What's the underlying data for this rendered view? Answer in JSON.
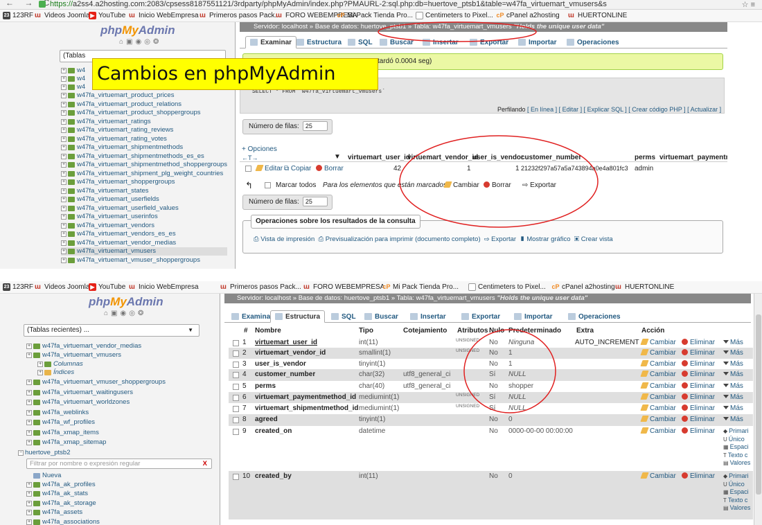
{
  "browser": {
    "url_prefix": "https://",
    "url": "a2ss4.a2hosting.com:2083/cpsess8187551121/3rdparty/phpMyAdmin/index.php?PMAURL-2:sql.php:db=huertove_ptsb1&table=w47fa_virtuemart_vmusers&s"
  },
  "bookmarks": [
    {
      "icon": "123rf-icon",
      "label": "123RF"
    },
    {
      "icon": "joomla-icon",
      "label": "Videos Joomla"
    },
    {
      "icon": "youtube-icon",
      "label": "YouTube"
    },
    {
      "icon": "joomla-icon",
      "label": "Inicio WebEmpresa"
    },
    {
      "icon": "joomla-icon",
      "label": "Primeros pasos Pack..."
    },
    {
      "icon": "joomla-icon",
      "label": "FORO WEBEMPRESA"
    },
    {
      "icon": "cpanel-icon",
      "label": "Mi Pack Tienda Pro..."
    },
    {
      "icon": "page-icon",
      "label": "Centimeters to Pixel..."
    },
    {
      "icon": "cpanel-icon",
      "label": "cPanel a2hosting"
    },
    {
      "icon": "joomla-icon",
      "label": "HUERTONLINE"
    }
  ],
  "logo": {
    "php": "php",
    "my": "My",
    "admin": "Admin"
  },
  "overlay_banner": "Cambios en phpMyAdmin",
  "top": {
    "recent_tables": "(Tablas",
    "tree": [
      "w47fa_virtuemart_product_prices",
      "w47fa_virtuemart_product_relations",
      "w47fa_virtuemart_product_shoppergroups",
      "w47fa_virtuemart_ratings",
      "w47fa_virtuemart_rating_reviews",
      "w47fa_virtuemart_rating_votes",
      "w47fa_virtuemart_shipmentmethods",
      "w47fa_virtuemart_shipmentmethods_es_es",
      "w47fa_virtuemart_shipmentmethod_shoppergroups",
      "w47fa_virtuemart_shipment_plg_weight_countries",
      "w47fa_virtuemart_shoppergroups",
      "w47fa_virtuemart_states",
      "w47fa_virtuemart_userfields",
      "w47fa_virtuemart_userfield_values",
      "w47fa_virtuemart_userinfos",
      "w47fa_virtuemart_vendors",
      "w47fa_virtuemart_vendors_es_es",
      "w47fa_virtuemart_vendor_medias",
      "w47fa_virtuemart_vmusers",
      "w47fa_virtuemart_vmuser_shoppergroups"
    ],
    "breadcrumb": {
      "server": "Servidor: localhost",
      "db": "Base de datos: huertove_ptsb1",
      "table": "Tabla: w47fa_virtuemart_vmusers",
      "comment": "\"Holds the unique user data\""
    },
    "tabs": [
      "Examinar",
      "Estructura",
      "SQL",
      "Buscar",
      "Insertar",
      "Exportar",
      "Importar",
      "Operaciones"
    ],
    "success_msg": "tardó 0.0004 seg)",
    "sql_query": "SELECT * FROM `w47fa_virtuemart_vmusers`",
    "profiling": "Perfilando",
    "sql_links": "[ En línea ] [ Editar ] [ Explicar SQL ] [ Crear código PHP ] [ Actualizar ]",
    "rows_label": "Número de filas:",
    "rows_value": "25",
    "options_label": "+ Opciones",
    "columns": [
      "virtuemart_user_id",
      "virtuemart_vendor_id",
      "user_is_vendor",
      "customer_number",
      "perms",
      "virtuemart_paymentmet"
    ],
    "row_actions": {
      "edit": "Editar",
      "copy": "Copiar",
      "delete": "Borrar"
    },
    "row": {
      "user_id": "42",
      "vendor_id": "1",
      "is_vendor": "1",
      "customer_number": "21232f297a57a5a743894a0e4a801fc3",
      "perms": "admin"
    },
    "bulk": {
      "check_all": "Marcar todos",
      "with_selected": "Para los elementos que están marcados:",
      "change": "Cambiar",
      "delete": "Borrar",
      "export": "Exportar"
    },
    "query_ops_title": "Operaciones sobre los resultados de la consulta",
    "query_ops": [
      "Vista de impresión",
      "Previsualización para imprimir (documento completo)",
      "Exportar",
      "Mostrar gráfico",
      "Crear vista"
    ]
  },
  "bottom": {
    "recent_tables": "(Tablas recientes) ...",
    "tree_before": [
      "w47fa_virtuemart_vendor_medias",
      "w47fa_virtuemart_vmusers"
    ],
    "sub": [
      "Columnas",
      "Índices"
    ],
    "tree_after": [
      "w47fa_virtuemart_vmuser_shoppergroups",
      "w47fa_virtuemart_waitingusers",
      "w47fa_virtuemart_worldzones",
      "w47fa_weblinks",
      "w47fa_wf_profiles",
      "w47fa_xmap_items",
      "w47fa_xmap_sitemap"
    ],
    "db2": "huertove_ptsb2",
    "filter_placeholder": "Filtrar por nombre o expresión regular",
    "filter_clear": "X",
    "new_label": "Nueva",
    "tree_db2": [
      "w47fa_ak_profiles",
      "w47fa_ak_stats",
      "w47fa_ak_storage",
      "w47fa_assets",
      "w47fa_associations"
    ],
    "breadcrumb": {
      "server": "Servidor: localhost",
      "db": "Base de datos: huertove_ptsb1",
      "table": "Tabla: w47fa_virtuemart_vmusers",
      "comment": "\"Holds the unique user data\""
    },
    "tabs": [
      "Examinar",
      "Estructura",
      "SQL",
      "Buscar",
      "Insertar",
      "Exportar",
      "Importar",
      "Operaciones"
    ],
    "headers": [
      "#",
      "Nombre",
      "Tipo",
      "Cotejamiento",
      "Atributos",
      "Nulo",
      "Predeterminado",
      "Extra",
      "Acción"
    ],
    "rows": [
      {
        "n": "1",
        "name": "virtuemart_user_id",
        "type": "int(11)",
        "coll": "",
        "attr": "UNSIGNED",
        "null": "No",
        "def": "Ninguna",
        "extra": "AUTO_INCREMENT"
      },
      {
        "n": "2",
        "name": "virtuemart_vendor_id",
        "type": "smallint(1)",
        "coll": "",
        "attr": "UNSIGNED",
        "null": "No",
        "def": "1",
        "extra": ""
      },
      {
        "n": "3",
        "name": "user_is_vendor",
        "type": "tinyint(1)",
        "coll": "",
        "attr": "",
        "null": "No",
        "def": "1",
        "extra": ""
      },
      {
        "n": "4",
        "name": "customer_number",
        "type": "char(32)",
        "coll": "utf8_general_ci",
        "attr": "",
        "null": "Sí",
        "def": "NULL",
        "extra": ""
      },
      {
        "n": "5",
        "name": "perms",
        "type": "char(40)",
        "coll": "utf8_general_ci",
        "attr": "",
        "null": "No",
        "def": "shopper",
        "extra": ""
      },
      {
        "n": "6",
        "name": "virtuemart_paymentmethod_id",
        "type": "mediumint(1)",
        "coll": "",
        "attr": "UNSIGNED",
        "null": "Sí",
        "def": "NULL",
        "extra": ""
      },
      {
        "n": "7",
        "name": "virtuemart_shipmentmethod_id",
        "type": "mediumint(1)",
        "coll": "",
        "attr": "UNSIGNED",
        "null": "Sí",
        "def": "NULL",
        "extra": ""
      },
      {
        "n": "8",
        "name": "agreed",
        "type": "tinyint(1)",
        "coll": "",
        "attr": "",
        "null": "No",
        "def": "0",
        "extra": ""
      },
      {
        "n": "9",
        "name": "created_on",
        "type": "datetime",
        "coll": "",
        "attr": "",
        "null": "No",
        "def": "0000-00-00 00:00:00",
        "extra": ""
      },
      {
        "n": "10",
        "name": "created_by",
        "type": "int(11)",
        "coll": "",
        "attr": "",
        "null": "No",
        "def": "0",
        "extra": ""
      }
    ],
    "actions": {
      "change": "Cambiar",
      "delete": "Eliminar",
      "more": "Más"
    },
    "extra_actions": [
      "Primari",
      "Único",
      "Espaci",
      "Texto c",
      "Valores"
    ]
  }
}
